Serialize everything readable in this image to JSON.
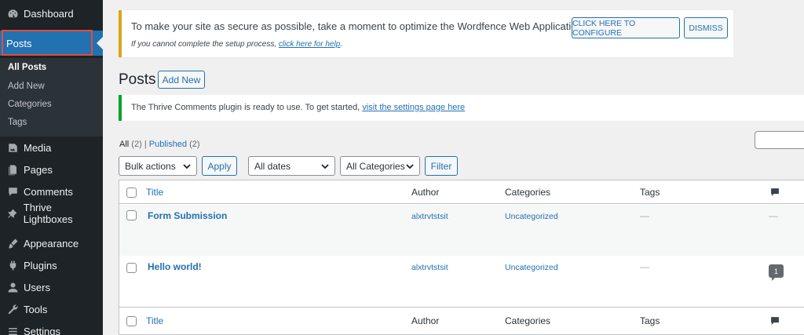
{
  "sidebar": {
    "items": [
      {
        "label": "Dashboard",
        "icon": "dashboard-icon"
      },
      {
        "label": "Posts",
        "icon": "pin-icon"
      },
      {
        "label": "Media",
        "icon": "media-icon"
      },
      {
        "label": "Pages",
        "icon": "pages-icon"
      },
      {
        "label": "Comments",
        "icon": "comments-icon"
      },
      {
        "label": "Thrive Lightboxes",
        "icon": "pin-icon"
      },
      {
        "label": "Appearance",
        "icon": "brush-icon"
      },
      {
        "label": "Plugins",
        "icon": "plugin-icon"
      },
      {
        "label": "Users",
        "icon": "user-icon"
      },
      {
        "label": "Tools",
        "icon": "wrench-icon"
      },
      {
        "label": "Settings",
        "icon": "settings-icon"
      }
    ],
    "posts_submenu": [
      "All Posts",
      "Add New",
      "Categories",
      "Tags"
    ]
  },
  "wordfence_notice": {
    "message": "To make your site as secure as possible, take a moment to optimize the Wordfence Web Application Firewall:",
    "configure_button": "CLICK HERE TO CONFIGURE",
    "dismiss_button": "DISMISS",
    "help_prefix": "If you cannot complete the setup process,",
    "help_link": "click here for help",
    "help_suffix": "."
  },
  "page": {
    "title": "Posts",
    "add_new": "Add New"
  },
  "thrive_notice": {
    "message": "The Thrive Comments plugin is ready to use. To get started,",
    "link": "visit the settings page here"
  },
  "filters": {
    "all_label": "All",
    "all_count": "(2)",
    "separator": "|",
    "published_label": "Published",
    "published_count": "(2)",
    "bulk_actions": "Bulk actions",
    "apply": "Apply",
    "all_dates": "All dates",
    "all_categories": "All Categories",
    "filter": "Filter"
  },
  "table": {
    "columns": {
      "title": "Title",
      "author": "Author",
      "categories": "Categories",
      "tags": "Tags"
    },
    "rows": [
      {
        "title": "Form Submission",
        "author": "alxtrvtstsit",
        "category": "Uncategorized",
        "tags": "—",
        "comments": "—"
      },
      {
        "title": "Hello world!",
        "author": "alxtrvtstsit",
        "category": "Uncategorized",
        "tags": "—",
        "comments": "1"
      }
    ]
  },
  "colors": {
    "sidebar_bg": "#1d2327",
    "accent": "#2271b1",
    "warning_border": "#dba617",
    "success_border": "#00a32a",
    "highlight_box": "#e74c3c"
  }
}
